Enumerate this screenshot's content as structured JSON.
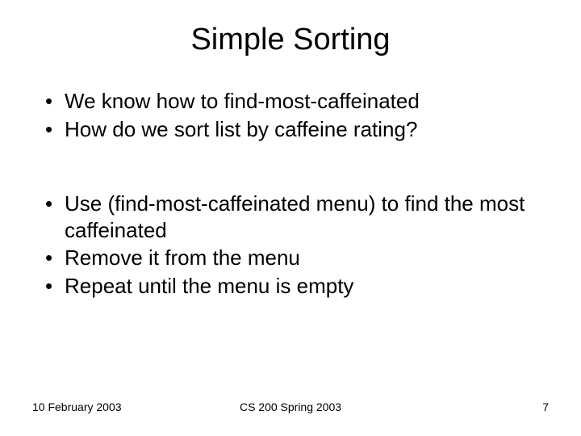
{
  "title": "Simple Sorting",
  "bullets_top": [
    "We know how to find-most-caffeinated",
    "How do we sort list by caffeine rating?"
  ],
  "bullets_bottom": [
    "Use (find-most-caffeinated menu) to find the most caffeinated",
    "Remove it from the menu",
    "Repeat until the menu is empty"
  ],
  "footer": {
    "date": "10 February 2003",
    "course": "CS 200 Spring 2003",
    "page": "7"
  }
}
